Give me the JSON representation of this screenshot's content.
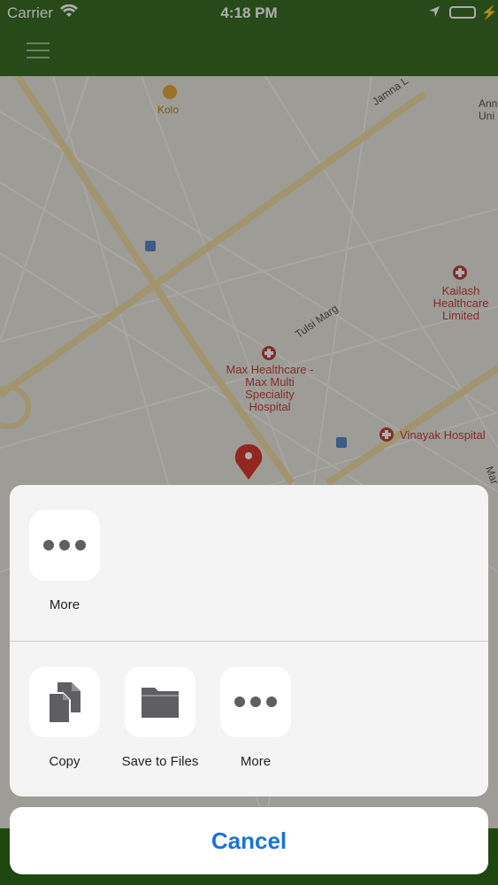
{
  "status_bar": {
    "carrier": "Carrier",
    "time": "4:18 PM"
  },
  "map": {
    "labels": {
      "kolo": "Kolo",
      "jamna": "Jamna L",
      "anni": "Ann",
      "uni": "Uni",
      "kailash_1": "Kailash",
      "kailash_2": "Healthcare",
      "kailash_3": "Limited",
      "tulsi": "Tulsi Marg",
      "max_1": "Max Healthcare -",
      "max_2": "Max Multi",
      "max_3": "Speciality",
      "max_4": "Hospital",
      "vinayak": "Vinayak Hospital",
      "mar": "Mar"
    }
  },
  "share_sheet": {
    "top_row": [
      {
        "label": "More",
        "icon": "more-dots-icon"
      }
    ],
    "action_row": [
      {
        "label": "Copy",
        "icon": "copy-icon"
      },
      {
        "label": "Save to Files",
        "icon": "folder-icon"
      },
      {
        "label": "More",
        "icon": "more-dots-icon"
      }
    ]
  },
  "cancel_label": "Cancel",
  "colors": {
    "nav": "#3a6e24",
    "accent": "#1a73d9",
    "hospital_red": "#c0413b",
    "pin": "#d93a2e"
  }
}
